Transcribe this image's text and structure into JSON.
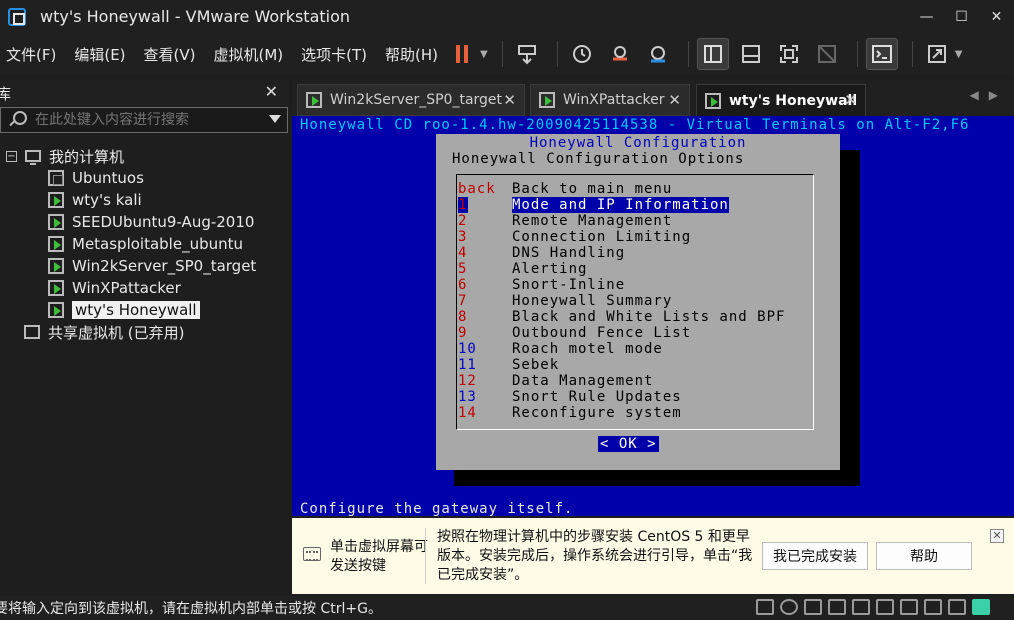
{
  "window": {
    "title": "wty's Honeywall - VMware Workstation"
  },
  "menu": [
    "文件(F)",
    "编辑(E)",
    "查看(V)",
    "虚拟机(M)",
    "选项卡(T)",
    "帮助(H)"
  ],
  "library": {
    "title": "库",
    "search_placeholder": "在此处键入内容进行搜索",
    "root": "我的计算机",
    "vms": [
      "Ubuntuos",
      "wty's kali",
      "SEEDUbuntu9-Aug-2010",
      "Metasploitable_ubuntu",
      "Win2kServer_SP0_target",
      "WinXPattacker",
      "wty's Honeywall"
    ],
    "shared": "共享虚拟机 (已弃用)"
  },
  "tabs": [
    "Win2kServer_SP0_target",
    "WinXPattacker",
    "wty's Honeywall"
  ],
  "console": {
    "top_line": "Honeywall CD roo-1.4.hw-20090425114538 - Virtual Terminals on Alt-F2,F6",
    "dialog_title": "Honeywall Configuration",
    "dialog_subtitle": "Honeywall Configuration Options",
    "items": [
      {
        "key": "back",
        "label": "Back to main menu"
      },
      {
        "key": "1",
        "label": "Mode and IP Information"
      },
      {
        "key": "2",
        "label": "Remote Management"
      },
      {
        "key": "3",
        "label": "Connection Limiting"
      },
      {
        "key": "4",
        "label": "DNS Handling"
      },
      {
        "key": "5",
        "label": "Alerting"
      },
      {
        "key": "6",
        "label": "Snort-Inline"
      },
      {
        "key": "7",
        "label": "Honeywall Summary"
      },
      {
        "key": "8",
        "label": "Black and White Lists and BPF"
      },
      {
        "key": "9",
        "label": "Outbound Fence List"
      },
      {
        "key": "10",
        "label": "Roach motel mode"
      },
      {
        "key": "11",
        "label": "Sebek"
      },
      {
        "key": "12",
        "label": "Data Management"
      },
      {
        "key": "13",
        "label": "Snort Rule Updates"
      },
      {
        "key": "14",
        "label": "Reconfigure system"
      }
    ],
    "ok_label": "< OK >",
    "status_line": "Configure the gateway itself."
  },
  "hint": {
    "left": "单击虚拟屏幕可发送按键",
    "main": "按照在物理计算机中的步骤安装 CentOS 5 和更早版本。安装完成后，操作系统会进行引导，单击“我已完成安装”。",
    "done_button": "我已完成安装",
    "help_button": "帮助"
  },
  "statusbar": {
    "message": "要将输入定向到该虚拟机，请在虚拟机内部单击或按 Ctrl+G。"
  }
}
